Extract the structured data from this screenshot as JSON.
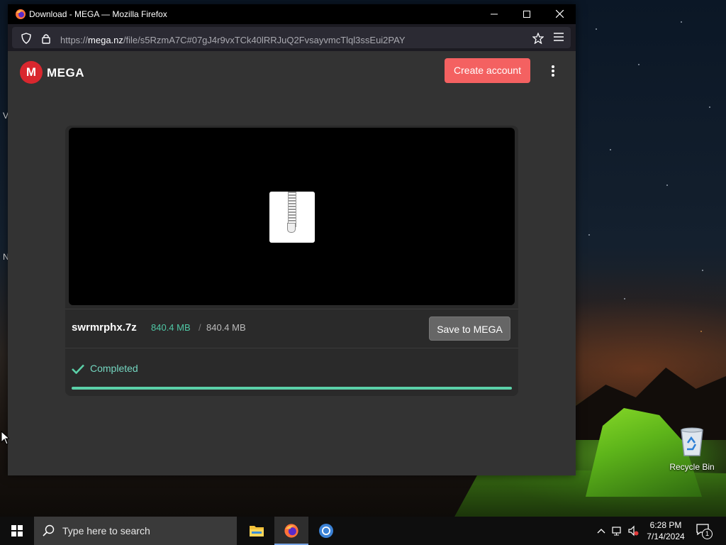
{
  "desktop": {
    "recycle_bin_label": "Recycle Bin",
    "edge_letters": [
      "V",
      "N",
      "(",
      "("
    ]
  },
  "window": {
    "title": "Download - MEGA — Mozilla Firefox",
    "url_prefix": "https://",
    "url_host": "mega.nz",
    "url_path": "/file/s5RzmA7C#07gJ4r9vxTCk40lRRJuQ2FvsayvmcTlql3ssEui2PAY"
  },
  "page": {
    "brand": "MEGA",
    "brand_initial": "M",
    "create_account_label": "Create account",
    "file_name": "swrmrphx.7z",
    "size_downloaded": "840.4 MB",
    "size_separator": "/",
    "size_total": "840.4 MB",
    "save_label": "Save to MEGA",
    "status": "Completed",
    "progress_percent": 100
  },
  "taskbar": {
    "search_placeholder": "Type here to search",
    "time": "6:28 PM",
    "date": "7/14/2024",
    "notification_count": "1"
  },
  "colors": {
    "accent": "#f46161",
    "success": "#5bd0a8",
    "mega_red": "#d9272e"
  }
}
